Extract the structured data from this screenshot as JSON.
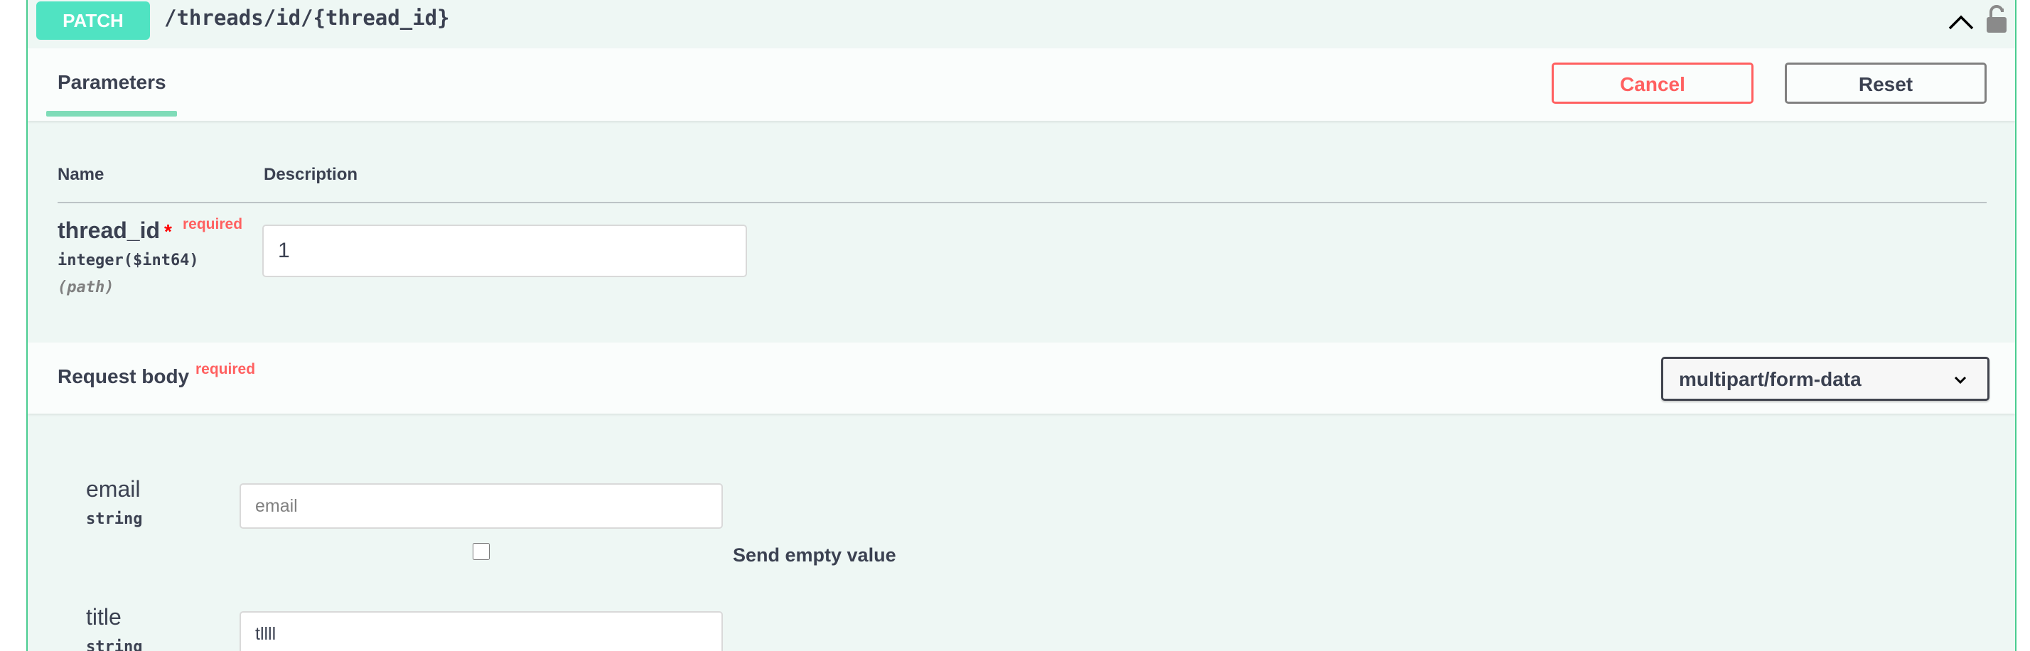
{
  "summary": {
    "method": "PATCH",
    "path": "/threads/id/{thread_id}"
  },
  "tabs": {
    "parameters_label": "Parameters",
    "cancel_label": "Cancel",
    "reset_label": "Reset"
  },
  "params_table": {
    "col_name": "Name",
    "col_description": "Description",
    "rows": [
      {
        "name": "thread_id",
        "required_marker": "*",
        "required_label": "required",
        "type": "integer($int64)",
        "location": "(path)",
        "value": "1"
      }
    ]
  },
  "request_body": {
    "title": "Request body",
    "required_label": "required",
    "content_type": "multipart/form-data",
    "fields": [
      {
        "label": "email",
        "type": "string",
        "placeholder": "email",
        "value": "",
        "send_empty_label": "Send empty value"
      },
      {
        "label": "title",
        "type": "string",
        "value": "tllll"
      }
    ]
  },
  "colors": {
    "method_green": "#49cc90",
    "method_badge": "#50e3c2",
    "cancel_red": "#ff6060",
    "text": "#3b4151"
  },
  "icons": {
    "collapse": "chevron-up-icon",
    "auth": "lock-open-icon",
    "select": "chevron-down-icon"
  }
}
